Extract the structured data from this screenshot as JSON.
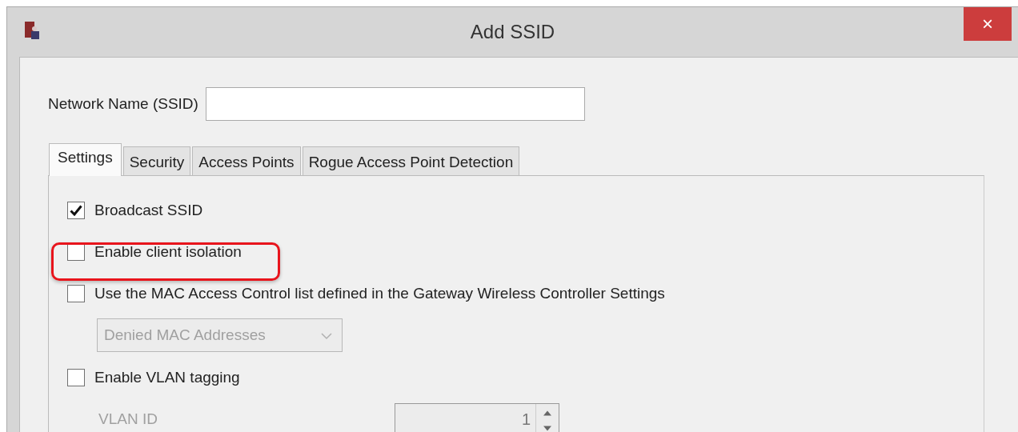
{
  "window": {
    "title": "Add SSID",
    "close": "×"
  },
  "network_name": {
    "label": "Network Name (SSID)"
  },
  "tabs": [
    {
      "label": "Settings",
      "selected": true
    },
    {
      "label": "Security",
      "selected": false
    },
    {
      "label": "Access Points",
      "selected": false
    },
    {
      "label": "Rogue Access Point Detection",
      "selected": false
    }
  ],
  "options": [
    {
      "kind": "checkbox",
      "label": "Broadcast SSID",
      "checked": true,
      "highlighted": false
    },
    {
      "kind": "checkbox",
      "label": "Enable client isolation",
      "checked": false,
      "highlighted": true
    },
    {
      "kind": "checkbox",
      "label": "Use the MAC Access Control list defined in the Gateway Wireless Controller Settings",
      "checked": false,
      "highlighted": false
    },
    {
      "kind": "dropdown",
      "value": "Denied MAC Addresses",
      "disabled": true
    },
    {
      "kind": "checkbox",
      "label": "Enable VLAN tagging",
      "checked": false,
      "highlighted": false
    },
    {
      "kind": "spinner",
      "label": "VLAN ID",
      "value": "1",
      "disabled": true
    }
  ]
}
